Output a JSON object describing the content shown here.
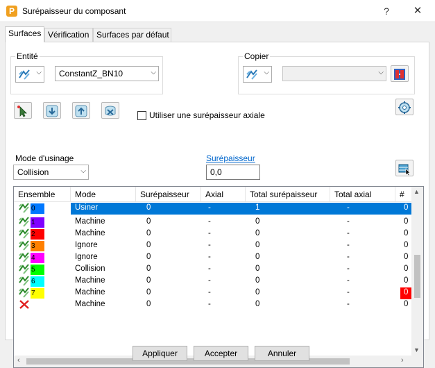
{
  "window": {
    "title": "Surépaisseur du composant",
    "help": "?",
    "close": "✕"
  },
  "tabs": [
    "Surfaces",
    "Vérification",
    "Surfaces par défaut"
  ],
  "entite": {
    "label": "Entité",
    "value": "ConstantZ_BN10"
  },
  "copier": {
    "label": "Copier",
    "value": ""
  },
  "axial_checkbox": {
    "label": "Utiliser une surépaisseur axiale",
    "checked": false
  },
  "mode_usinage": {
    "label": "Mode d'usinage",
    "value": "Collision"
  },
  "surepaisseur": {
    "label": "Surépaisseur",
    "value": "0,0"
  },
  "table": {
    "columns": [
      "Ensemble",
      "Mode",
      "Surépaisseur",
      "Axial",
      "Total surépaisseur",
      "Total axial",
      "#"
    ],
    "rows": [
      {
        "set": "0",
        "color": "#0078ff",
        "mode": "Usiner",
        "sur": "0",
        "axial": "-",
        "total": "1",
        "total_axial": "-",
        "hash": "0",
        "selected": true,
        "hash_color": ""
      },
      {
        "set": "1",
        "color": "#8000ff",
        "mode": "Machine",
        "sur": "0",
        "axial": "-",
        "total": "0",
        "total_axial": "-",
        "hash": "0",
        "selected": false,
        "hash_color": ""
      },
      {
        "set": "2",
        "color": "#ff0000",
        "mode": "Machine",
        "sur": "0",
        "axial": "-",
        "total": "0",
        "total_axial": "-",
        "hash": "0",
        "selected": false,
        "hash_color": ""
      },
      {
        "set": "3",
        "color": "#ff8000",
        "mode": "Ignore",
        "sur": "0",
        "axial": "-",
        "total": "0",
        "total_axial": "-",
        "hash": "0",
        "selected": false,
        "hash_color": ""
      },
      {
        "set": "4",
        "color": "#ff00ff",
        "mode": "Ignore",
        "sur": "0",
        "axial": "-",
        "total": "0",
        "total_axial": "-",
        "hash": "0",
        "selected": false,
        "hash_color": ""
      },
      {
        "set": "5",
        "color": "#00ff00",
        "mode": "Collision",
        "sur": "0",
        "axial": "-",
        "total": "0",
        "total_axial": "-",
        "hash": "0",
        "selected": false,
        "hash_color": ""
      },
      {
        "set": "6",
        "color": "#00ffff",
        "mode": "Machine",
        "sur": "0",
        "axial": "-",
        "total": "0",
        "total_axial": "-",
        "hash": "0",
        "selected": false,
        "hash_color": ""
      },
      {
        "set": "7",
        "color": "#ffff00",
        "mode": "Machine",
        "sur": "0",
        "axial": "-",
        "total": "0",
        "total_axial": "-",
        "hash": "0",
        "selected": false,
        "hash_color": "#ff0000"
      },
      {
        "set": "",
        "color": "",
        "mode": "Machine",
        "sur": "0",
        "axial": "-",
        "total": "0",
        "total_axial": "-",
        "hash": "0",
        "selected": false,
        "hash_color": "",
        "removed": true
      }
    ]
  },
  "buttons": {
    "apply": "Appliquer",
    "accept": "Accepter",
    "cancel": "Annuler"
  }
}
